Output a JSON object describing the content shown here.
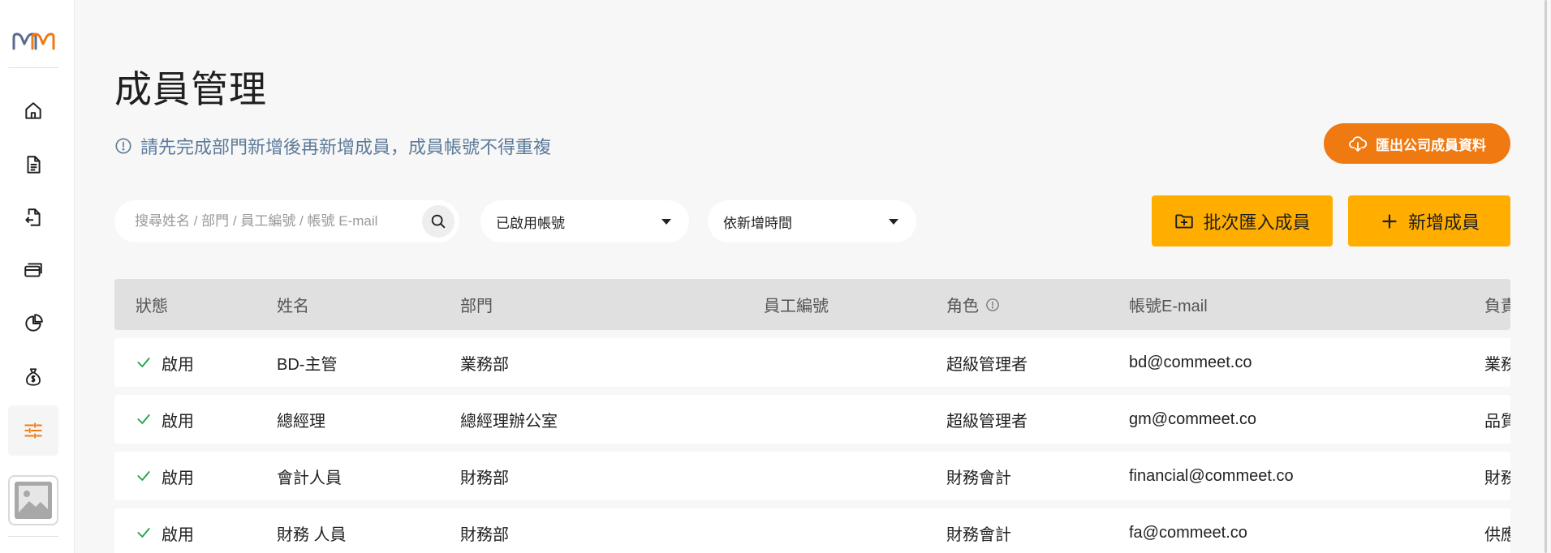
{
  "colors": {
    "accent_orange": "#f07a12",
    "accent_yellow": "#ffae00",
    "notice_text": "#5d7b9a",
    "status_green": "#22a447",
    "header_bg": "#e0e0e0",
    "page_bg": "#f7f7f7"
  },
  "sidebar": {
    "logo_icon": "mm-logo",
    "items": [
      {
        "icon": "home-icon"
      },
      {
        "icon": "document-icon"
      },
      {
        "icon": "document-return-icon"
      },
      {
        "icon": "cards-icon"
      },
      {
        "icon": "pie-chart-icon"
      },
      {
        "icon": "money-bag-icon"
      },
      {
        "icon": "sliders-icon",
        "active": true
      }
    ],
    "avatar_icon": "image-placeholder-icon"
  },
  "page": {
    "title": "成員管理",
    "notice": "請先完成部門新增後再新增成員，成員帳號不得重複",
    "export_label": "匯出公司成員資料"
  },
  "filters": {
    "search_placeholder": "搜尋姓名 / 部門 / 員工編號 / 帳號 E-mail",
    "search_value": "",
    "status_select": "已啟用帳號",
    "sort_select": "依新增時間"
  },
  "actions": {
    "batch_import_label": "批次匯入成員",
    "add_member_label": "新增成員"
  },
  "table": {
    "headers": {
      "status": "狀態",
      "name": "姓名",
      "department": "部門",
      "employee_id": "員工編號",
      "role": "角色",
      "email": "帳號E-mail",
      "owner": "負責"
    },
    "rows": [
      {
        "status": "啟用",
        "name": "BD-主管",
        "department": "業務部",
        "employee_id": "",
        "role": "超級管理者",
        "email": "bd@commeet.co",
        "owner": "業務"
      },
      {
        "status": "啟用",
        "name": "總經理",
        "department": "總經理辦公室",
        "employee_id": "",
        "role": "超級管理者",
        "email": "gm@commeet.co",
        "owner": "品質"
      },
      {
        "status": "啟用",
        "name": "會計人員",
        "department": "財務部",
        "employee_id": "",
        "role": "財務會計",
        "email": "financial@commeet.co",
        "owner": "財務"
      },
      {
        "status": "啟用",
        "name": "財務 人員",
        "department": "財務部",
        "employee_id": "",
        "role": "財務會計",
        "email": "fa@commeet.co",
        "owner": "供應"
      }
    ]
  }
}
